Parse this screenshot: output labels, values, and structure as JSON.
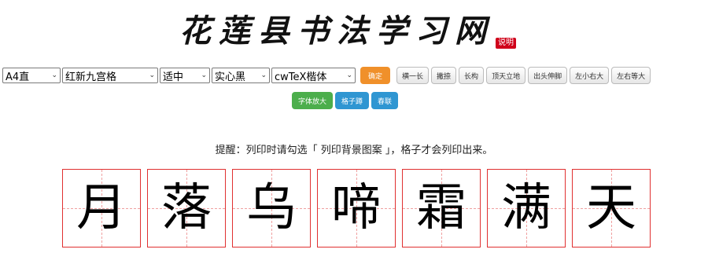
{
  "logo": {
    "text": "花莲县书法学习网",
    "badge": "说明"
  },
  "toolbar": {
    "selects": [
      {
        "name": "paper-size-select",
        "value": "A4直",
        "width": 74
      },
      {
        "name": "grid-style-select",
        "value": "红新九宫格",
        "width": 122
      },
      {
        "name": "size-select",
        "value": "适中",
        "width": 64
      },
      {
        "name": "color-select",
        "value": "实心黑",
        "width": 74
      },
      {
        "name": "font-select",
        "value": "cwTeX楷体",
        "width": 107
      }
    ],
    "confirm_label": "确定",
    "stroke_buttons": [
      "横一长",
      "撇捺",
      "长构",
      "顶天立地",
      "出头伸脚",
      "左小右大",
      "左右等大"
    ]
  },
  "actions": {
    "enlarge_label": "字体放大",
    "grid_label": "格子蹲",
    "couplet_label": "春联"
  },
  "notice": "提醒：列印时请勾选「 列印背景图案 」，格子才会列印出来。",
  "characters": [
    "月",
    "落",
    "乌",
    "啼",
    "霜",
    "满",
    "天"
  ]
}
